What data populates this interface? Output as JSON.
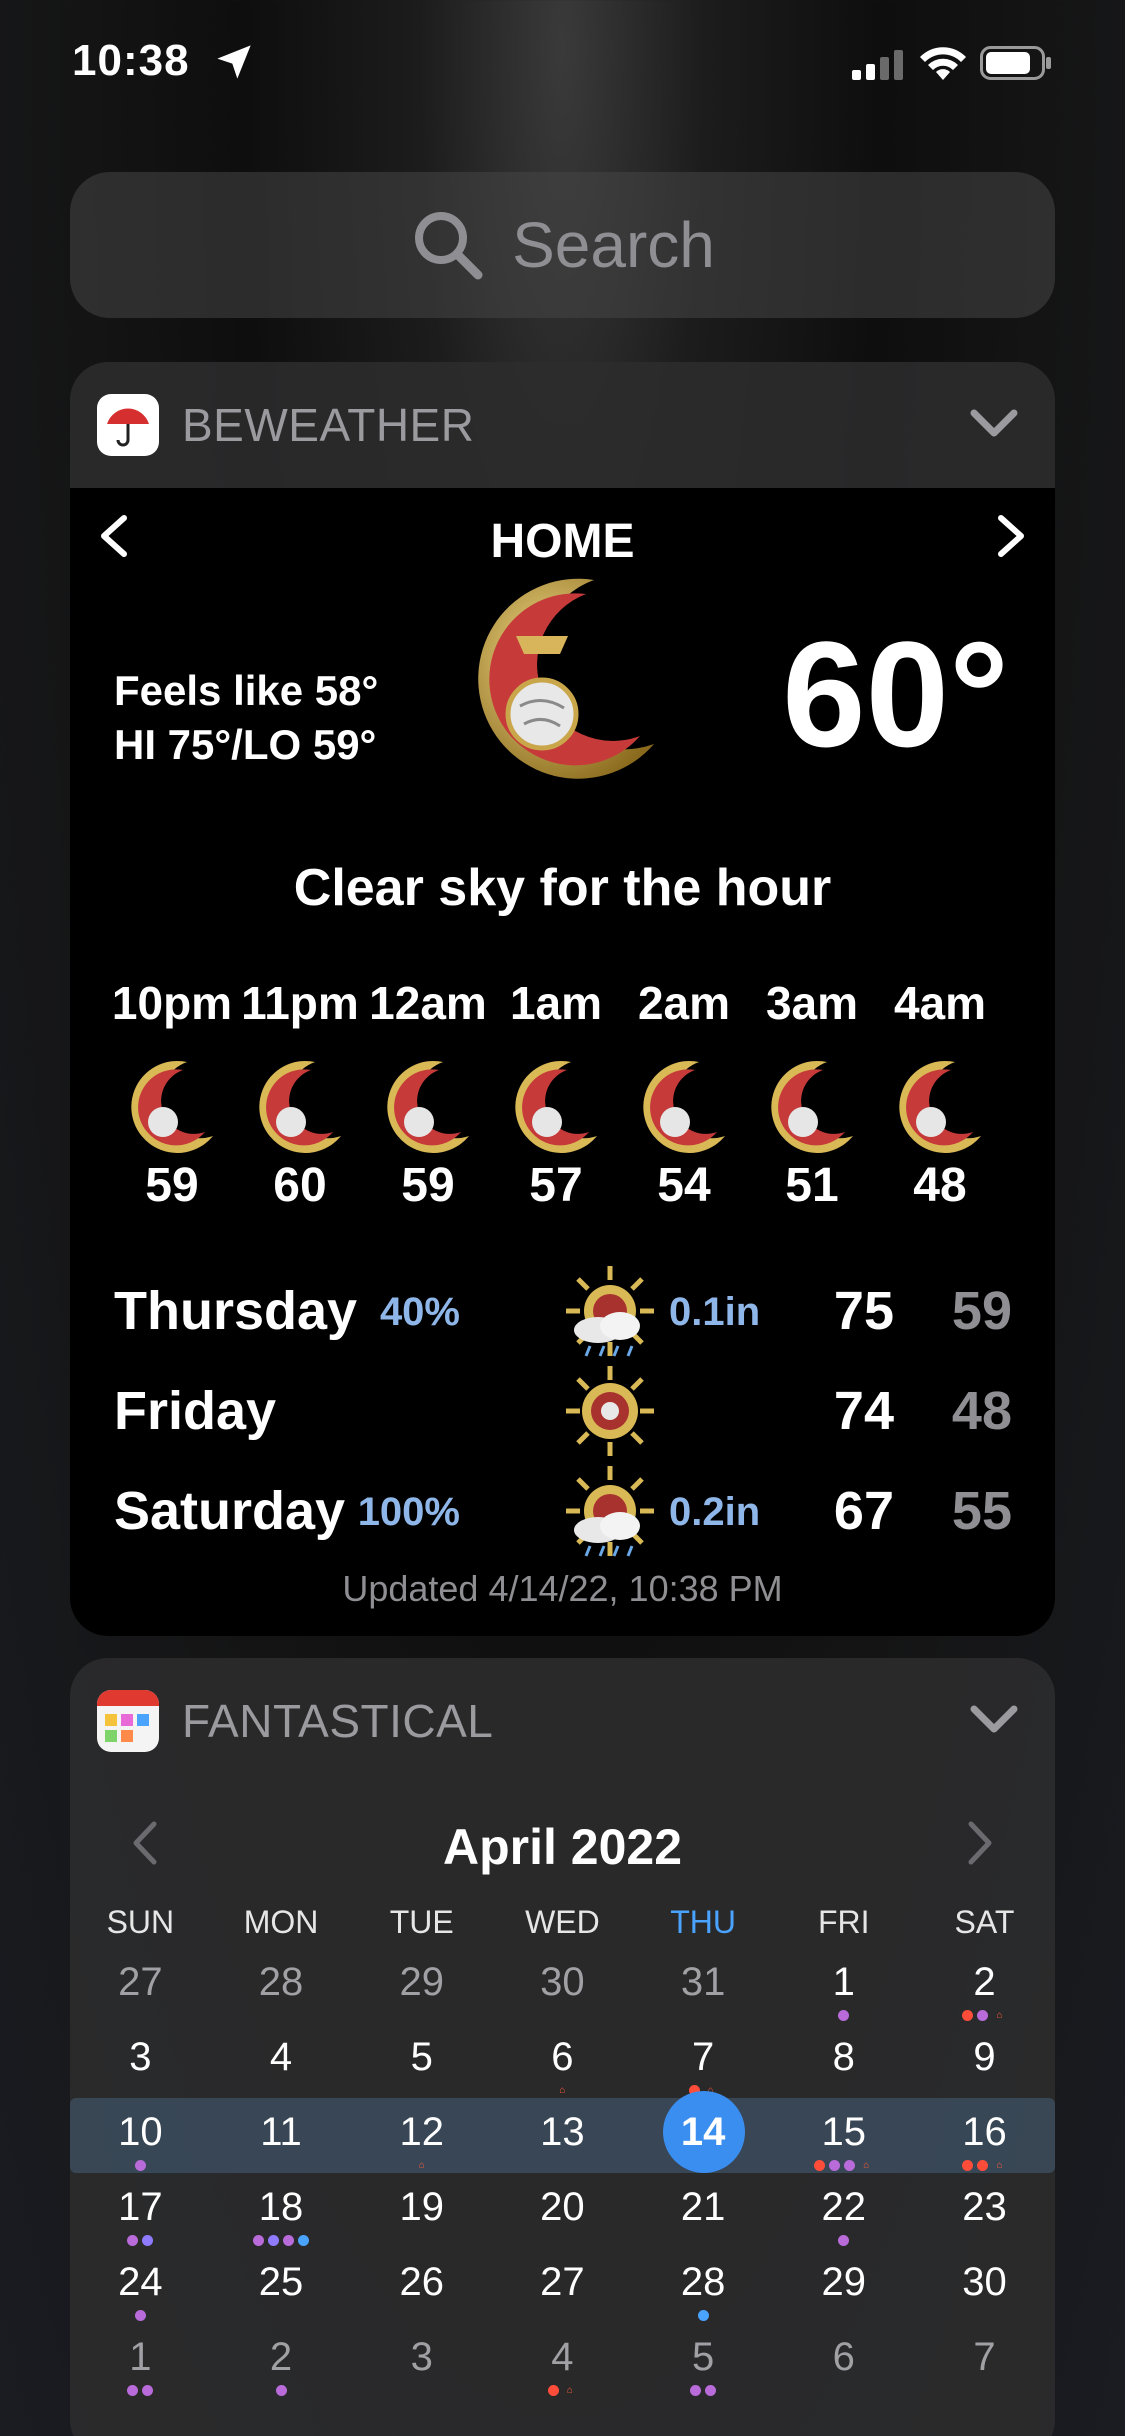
{
  "status_bar": {
    "time": "10:38"
  },
  "search": {
    "placeholder": "Search"
  },
  "beweather": {
    "title": "BEWEATHER",
    "location": "HOME",
    "feels_like": "Feels like 58°",
    "hi_lo": "HI 75°/LO 59°",
    "temperature": "60°",
    "summary": "Clear sky for the hour",
    "hourly": [
      {
        "label": "10pm",
        "temp": "59"
      },
      {
        "label": "11pm",
        "temp": "60"
      },
      {
        "label": "12am",
        "temp": "59"
      },
      {
        "label": "1am",
        "temp": "57"
      },
      {
        "label": "2am",
        "temp": "54"
      },
      {
        "label": "3am",
        "temp": "51"
      },
      {
        "label": "4am",
        "temp": "48"
      }
    ],
    "daily": [
      {
        "name": "Thursday",
        "precip_pct": "40%",
        "precip_amt": "0.1in",
        "hi": "75",
        "lo": "59",
        "icon": "sun-rain-icon"
      },
      {
        "name": "Friday",
        "precip_pct": "",
        "precip_amt": "",
        "hi": "74",
        "lo": "48",
        "icon": "sun-icon"
      },
      {
        "name": "Saturday",
        "precip_pct": "100%",
        "precip_amt": "0.2in",
        "hi": "67",
        "lo": "55",
        "icon": "sun-rain-icon"
      }
    ],
    "updated": "Updated 4/14/22, 10:38 PM"
  },
  "fantastical": {
    "title": "FANTASTICAL",
    "month": "April 2022",
    "weekdays": [
      "SUN",
      "MON",
      "TUE",
      "WED",
      "THU",
      "FRI",
      "SAT"
    ],
    "today_weekday_index": 4,
    "weeks": [
      {
        "highlight": false,
        "days": [
          {
            "n": "27",
            "kind": "prev",
            "dots": []
          },
          {
            "n": "28",
            "kind": "prev",
            "dots": []
          },
          {
            "n": "29",
            "kind": "prev",
            "dots": []
          },
          {
            "n": "30",
            "kind": "prev",
            "dots": []
          },
          {
            "n": "31",
            "kind": "prev",
            "dots": []
          },
          {
            "n": "1",
            "kind": "cur",
            "dots": [
              "#b86bd9"
            ]
          },
          {
            "n": "2",
            "kind": "cur",
            "dots": [
              "#ff4d3a",
              "#b86bd9",
              "bday"
            ]
          }
        ]
      },
      {
        "highlight": false,
        "days": [
          {
            "n": "3",
            "kind": "cur",
            "dots": []
          },
          {
            "n": "4",
            "kind": "cur",
            "dots": []
          },
          {
            "n": "5",
            "kind": "cur",
            "dots": []
          },
          {
            "n": "6",
            "kind": "cur",
            "dots": [
              "bday"
            ]
          },
          {
            "n": "7",
            "kind": "cur",
            "dots": [
              "#ff4d3a",
              "bday"
            ]
          },
          {
            "n": "8",
            "kind": "cur",
            "dots": []
          },
          {
            "n": "9",
            "kind": "cur",
            "dots": []
          }
        ]
      },
      {
        "highlight": true,
        "days": [
          {
            "n": "10",
            "kind": "cur",
            "dots": [
              "#b86bd9"
            ]
          },
          {
            "n": "11",
            "kind": "cur",
            "dots": []
          },
          {
            "n": "12",
            "kind": "cur",
            "dots": [
              "bday"
            ]
          },
          {
            "n": "13",
            "kind": "cur",
            "dots": []
          },
          {
            "n": "14",
            "kind": "today",
            "dots": []
          },
          {
            "n": "15",
            "kind": "cur",
            "dots": [
              "#ff4d3a",
              "#b86bd9",
              "#b86bd9",
              "bday"
            ]
          },
          {
            "n": "16",
            "kind": "cur",
            "dots": [
              "#ff4d3a",
              "#ff4d3a",
              "bday"
            ]
          }
        ]
      },
      {
        "highlight": false,
        "days": [
          {
            "n": "17",
            "kind": "cur",
            "dots": [
              "#b86bd9",
              "#8f7bff"
            ]
          },
          {
            "n": "18",
            "kind": "cur",
            "dots": [
              "#b86bd9",
              "#8f7bff",
              "#b86bd9",
              "#4aa3ff"
            ]
          },
          {
            "n": "19",
            "kind": "cur",
            "dots": []
          },
          {
            "n": "20",
            "kind": "cur",
            "dots": []
          },
          {
            "n": "21",
            "kind": "cur",
            "dots": []
          },
          {
            "n": "22",
            "kind": "cur",
            "dots": [
              "#b86bd9"
            ]
          },
          {
            "n": "23",
            "kind": "cur",
            "dots": []
          }
        ]
      },
      {
        "highlight": false,
        "days": [
          {
            "n": "24",
            "kind": "cur",
            "dots": [
              "#b86bd9"
            ]
          },
          {
            "n": "25",
            "kind": "cur",
            "dots": []
          },
          {
            "n": "26",
            "kind": "cur",
            "dots": []
          },
          {
            "n": "27",
            "kind": "cur",
            "dots": []
          },
          {
            "n": "28",
            "kind": "cur",
            "dots": [
              "#4aa3ff"
            ]
          },
          {
            "n": "29",
            "kind": "cur",
            "dots": []
          },
          {
            "n": "30",
            "kind": "cur",
            "dots": []
          }
        ]
      },
      {
        "highlight": false,
        "days": [
          {
            "n": "1",
            "kind": "next",
            "dots": [
              "#b86bd9",
              "#b86bd9"
            ]
          },
          {
            "n": "2",
            "kind": "next",
            "dots": [
              "#b86bd9"
            ]
          },
          {
            "n": "3",
            "kind": "next",
            "dots": []
          },
          {
            "n": "4",
            "kind": "next",
            "dots": [
              "#ff4d3a",
              "bday"
            ]
          },
          {
            "n": "5",
            "kind": "next",
            "dots": [
              "#b86bd9",
              "#b86bd9"
            ]
          },
          {
            "n": "6",
            "kind": "next",
            "dots": []
          },
          {
            "n": "7",
            "kind": "next",
            "dots": []
          }
        ]
      }
    ]
  },
  "colors": {
    "accent": "#3a8ef0",
    "precip": "#8fb6e8",
    "muted": "#8e8e93"
  }
}
